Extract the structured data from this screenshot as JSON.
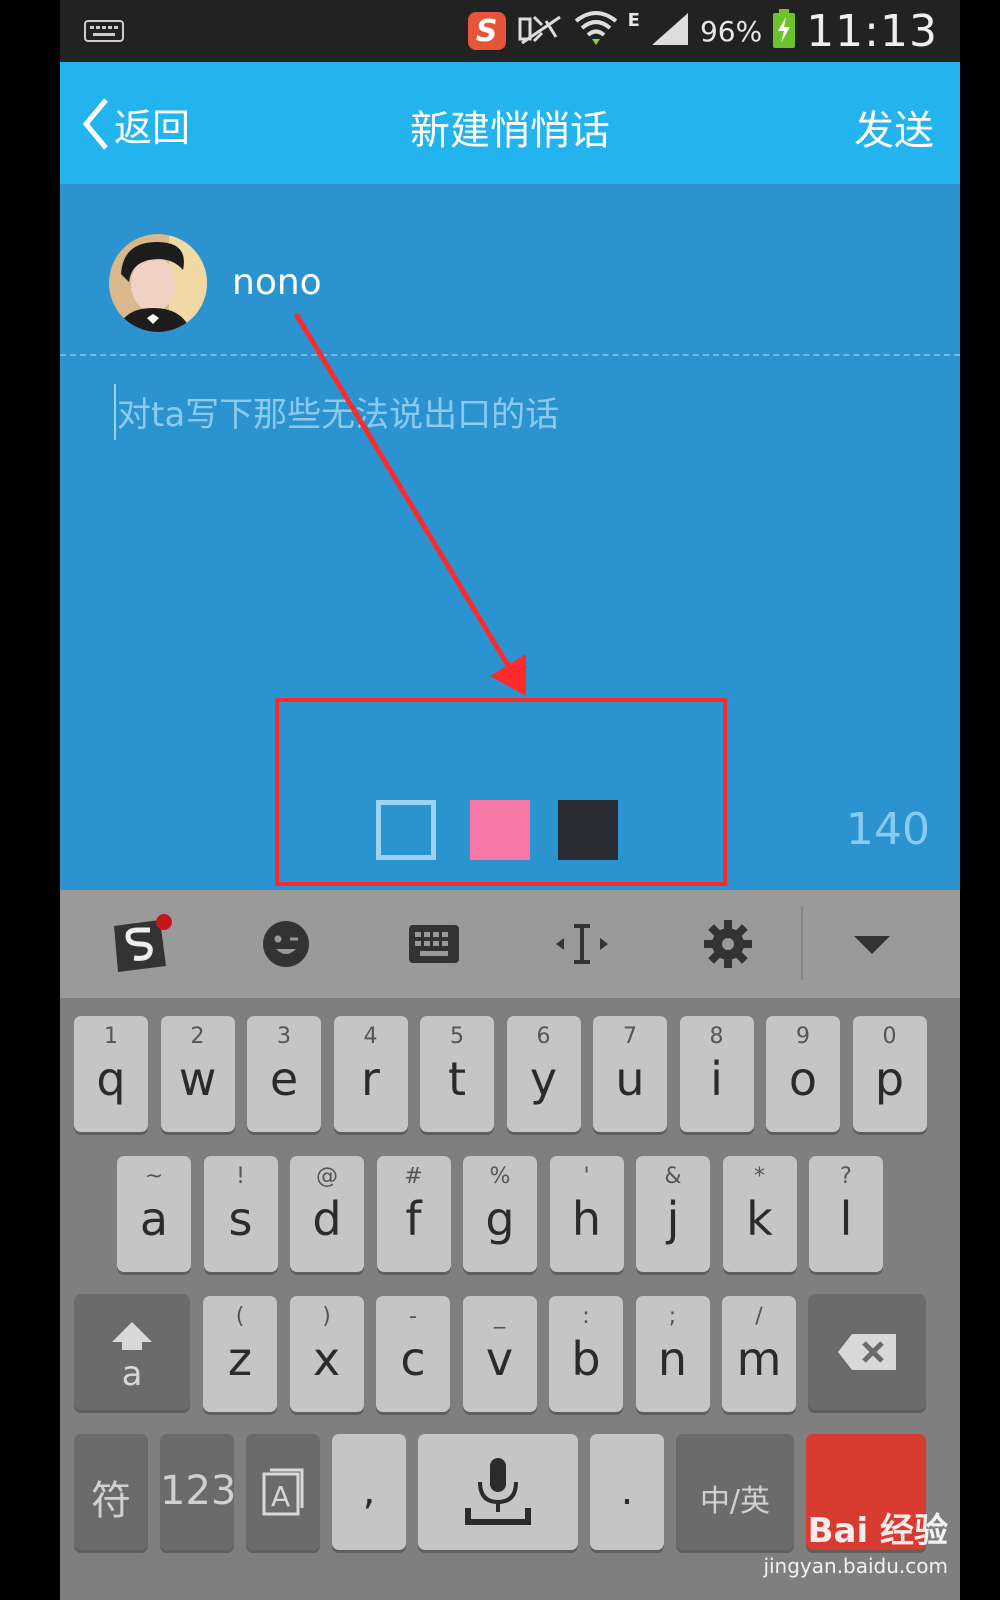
{
  "status_bar": {
    "battery": "96%",
    "time": "11:13",
    "network_type": "E",
    "icons": [
      "keyboard-icon",
      "sogou-icon",
      "mute-icon",
      "wifi-icon",
      "signal-icon",
      "battery-icon"
    ]
  },
  "header": {
    "back_label": "返回",
    "title": "新建悄悄话",
    "send_label": "发送",
    "color": "#23b4ef"
  },
  "compose": {
    "recipient_name": "nono",
    "placeholder": "对ta写下那些无法说出口的话",
    "char_count": "140",
    "background": "#2a93d0",
    "color_options": [
      {
        "name": "white-outline",
        "color": "#9dd3f0"
      },
      {
        "name": "pink",
        "color": "#f778a6"
      },
      {
        "name": "dark",
        "color": "#292d33"
      }
    ]
  },
  "keyboard": {
    "toolbar_icons": [
      "sogou-icon",
      "emoji-icon",
      "keyboard-icon",
      "cursor-icon",
      "gear-icon",
      "dropdown-icon"
    ],
    "row1": [
      {
        "hint": "1",
        "key": "q"
      },
      {
        "hint": "2",
        "key": "w"
      },
      {
        "hint": "3",
        "key": "e"
      },
      {
        "hint": "4",
        "key": "r"
      },
      {
        "hint": "5",
        "key": "t"
      },
      {
        "hint": "6",
        "key": "y"
      },
      {
        "hint": "7",
        "key": "u"
      },
      {
        "hint": "8",
        "key": "i"
      },
      {
        "hint": "9",
        "key": "o"
      },
      {
        "hint": "0",
        "key": "p"
      }
    ],
    "row2": [
      {
        "hint": "~",
        "key": "a"
      },
      {
        "hint": "!",
        "key": "s"
      },
      {
        "hint": "@",
        "key": "d"
      },
      {
        "hint": "#",
        "key": "f"
      },
      {
        "hint": "%",
        "key": "g"
      },
      {
        "hint": "'",
        "key": "h"
      },
      {
        "hint": "&",
        "key": "j"
      },
      {
        "hint": "*",
        "key": "k"
      },
      {
        "hint": "?",
        "key": "l"
      }
    ],
    "row3": [
      {
        "hint": "(",
        "key": "z"
      },
      {
        "hint": ")",
        "key": "x"
      },
      {
        "hint": "-",
        "key": "c"
      },
      {
        "hint": "_",
        "key": "v"
      },
      {
        "hint": ":",
        "key": "b"
      },
      {
        "hint": ";",
        "key": "n"
      },
      {
        "hint": "/",
        "key": "m"
      }
    ],
    "shift_label": "a",
    "symbols_label": "符",
    "numbers_label": "123",
    "comma_label": ",",
    "period_label": ".",
    "lang_label": "中/英"
  },
  "watermark": {
    "logo": "Bai 经验",
    "url": "jingyan.baidu.com"
  }
}
